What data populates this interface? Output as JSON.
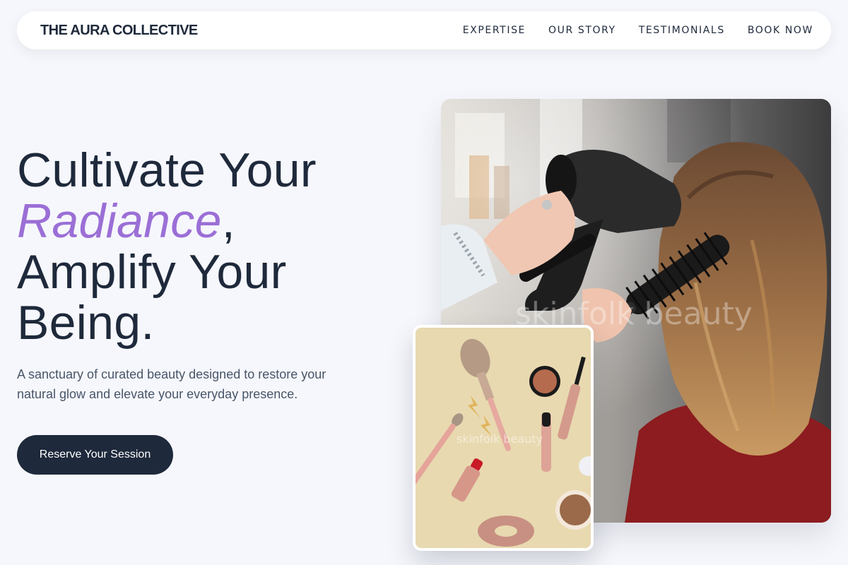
{
  "nav": {
    "brand": "THE AURA COLLECTIVE",
    "links": [
      "EXPERTISE",
      "OUR STORY",
      "TESTIMONIALS",
      "BOOK NOW"
    ]
  },
  "hero": {
    "headline_line1": "Cultivate Your",
    "headline_accent": "Radiance",
    "headline_comma": ",",
    "headline_line3": "Amplify Your",
    "headline_line4": "Being.",
    "tagline": "A sanctuary of curated beauty designed to restore your natural glow and elevate your everyday presence.",
    "cta_label": "Reserve Your Session"
  },
  "images": {
    "main_watermark": "skinfolk beauty",
    "small_watermark": "skinfolk beauty"
  },
  "colors": {
    "background": "#f6f7fc",
    "primary": "#1e293b",
    "accent": "#9b6fd6",
    "muted_text": "#475569"
  }
}
